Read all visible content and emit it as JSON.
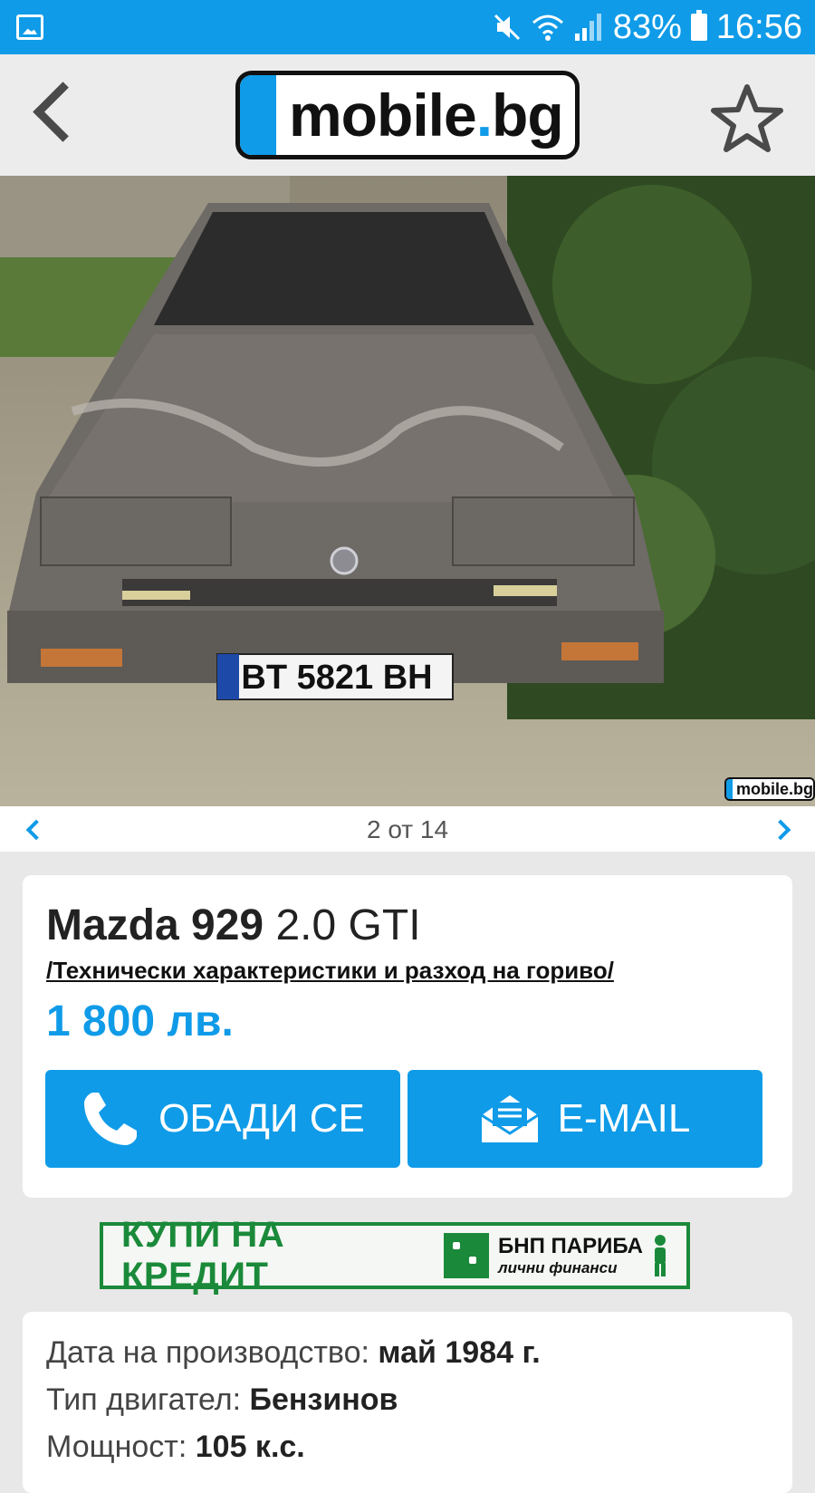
{
  "status_bar": {
    "battery": "83%",
    "time": "16:56"
  },
  "header": {
    "logo_text_main": "mobile",
    "logo_dot": ".",
    "logo_text_tld": "bg"
  },
  "photo": {
    "watermark": "mobile.bg",
    "plate": "BT 5821 BH",
    "counter": "2 от 14"
  },
  "listing": {
    "make_model": "Mazda 929",
    "variant": "2.0 GTI",
    "specs_link": "/Технически характеристики и разход на гориво/",
    "price": "1 800 лв.",
    "call_label": "ОБАДИ СЕ",
    "email_label": "E-MAIL"
  },
  "banner": {
    "text": "КУПИ НА КРЕДИТ",
    "bank_line1": "БНП ПАРИБА",
    "bank_line2": "лични финанси"
  },
  "details": [
    {
      "label": "Дата на производство: ",
      "value": "май 1984 г."
    },
    {
      "label": "Тип двигател: ",
      "value": "Бензинов"
    },
    {
      "label": "Мощност: ",
      "value": "105 к.с."
    }
  ],
  "colors": {
    "accent": "#0f9be8",
    "banner_green": "#1a8a3a"
  }
}
